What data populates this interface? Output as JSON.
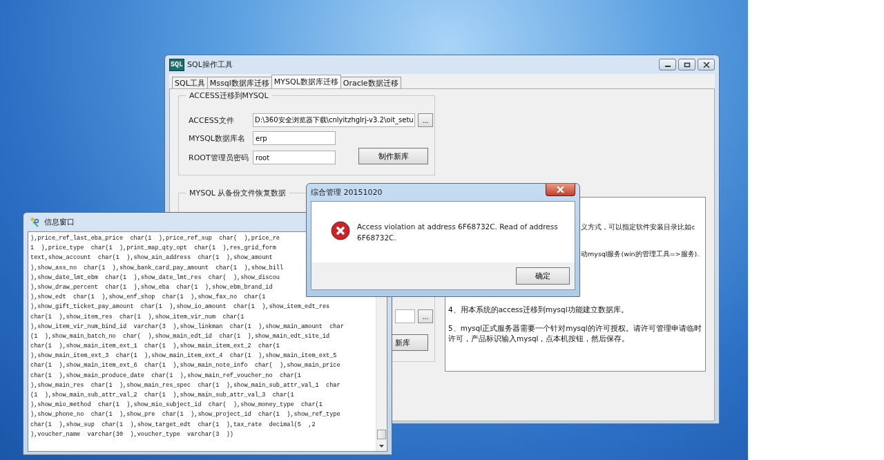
{
  "main_window": {
    "title": "SQL操作工具",
    "logo": "SQL",
    "tabs": [
      {
        "label": "SQL工具",
        "selected": false
      },
      {
        "label": "Mssql数据库迁移",
        "selected": false
      },
      {
        "label": "MYSQL数据库迁移",
        "selected": true
      },
      {
        "label": "Oracle数据迁移",
        "selected": false
      }
    ],
    "access_group": {
      "title": "ACCESS迁移到MYSQL",
      "fields": [
        {
          "label": "ACCESS文件",
          "value": "D:\\360安全浏览器下载\\cnlyitzhglrj-v3.2\\oit_setu",
          "browse": "..."
        },
        {
          "label": "MYSQL数据库名",
          "value": "erp"
        },
        {
          "label": "ROOT管理员密码",
          "value": "root"
        }
      ],
      "button": "制作新库"
    },
    "restore_group": {
      "title": "MYSQL  从备份文件恢复数据",
      "browse": "...",
      "button": "新库"
    },
    "help_panel": {
      "lines": [
        {
          "kind": "clipped",
          "text": "义方式，可以指定软件安装目录比如c"
        },
        {
          "kind": "clipped",
          "text": "动mysql服务(win的管理工具=>服务)."
        },
        {
          "kind": "full",
          "text": "4、用本系统的access迁移到mysql功能建立数据库。"
        },
        {
          "kind": "full",
          "text": "5、mysql正式服务器需要一个针对mysql的许可授权。请许可管理申请临时许可，产品标识输入mysql，点本机按钮，然后保存。"
        }
      ]
    }
  },
  "info_window": {
    "title": "信息窗口",
    "lines": [
      "),price_ref_last_eba_price  char(1  ),price_ref_sup  char(  ),price_re",
      "1  ),price_type  char(1  ),print_map_qty_opt  char(1  ),res_grid_form",
      "text,show_account  char(1  ),show_ain_address  char(1  ),show_amount",
      "),show_ass_no  char(1  ),show_bank_card_pay_amount  char(1  ),show_bill",
      "),show_date_lmt_ebm  char(1  ),show_date_lmt_res  char(  ),show_discou",
      "),show_draw_percent  char(1  ),show_eba  char(1  ),show_ebm_brand_id",
      "),show_edt  char(1  ),show_enf_shop  char(1  ),show_fax_no  char(1",
      "),show_gift_ticket_pay_amount  char(1  ),show_io_amount  char(1  ),show_item_edt_res",
      "char(1  ),show_item_res  char(1  ),show_item_vir_num  char(1",
      "),show_item_vir_num_bind_id  varchar(3  ),show_linkman  char(1  ),show_main_amount  char",
      "(1  ),show_main_batch_no  char(  ),show_main_edt_id  char(1  ),show_main_edt_site_id",
      "char(1  ),show_main_item_ext_1  char(1  ),show_main_item_ext_2  char(1",
      "),show_main_item_ext_3  char(1  ),show_main_item_ext_4  char(1  ),show_main_item_ext_5",
      "char(1  ),show_main_item_ext_6  char(1  ),show_main_note_info  char(  ),show_main_price",
      "char(1  ),show_main_produce_date  char(1  ),show_main_ref_voucher_no  char(1",
      "),show_main_res  char(1  ),show_main_res_spec  char(1  ),show_main_sub_attr_val_1  char",
      "(1  ),show_main_sub_attr_val_2  char(1  ),show_main_sub_attr_val_3  char(1",
      "),show_mio_method  char(1  ),show_mio_subject_id  char(  ),show_money_type  char(1",
      "),show_phone_no  char(1  ),show_pre  char(1  ),show_project_id  char(1  ),show_ref_type",
      "char(1  ),show_sup  char(1  ),show_target_edt  char(1  ),tax_rate  decimal(5  ,2",
      "),voucher_name  varchar(30  ),voucher_type  varchar(3  ))"
    ]
  },
  "dialog": {
    "title": "综合管理 20151020",
    "message": "Access violation at address 6F68732C. Read of address 6F68732C.",
    "button": "确定"
  }
}
